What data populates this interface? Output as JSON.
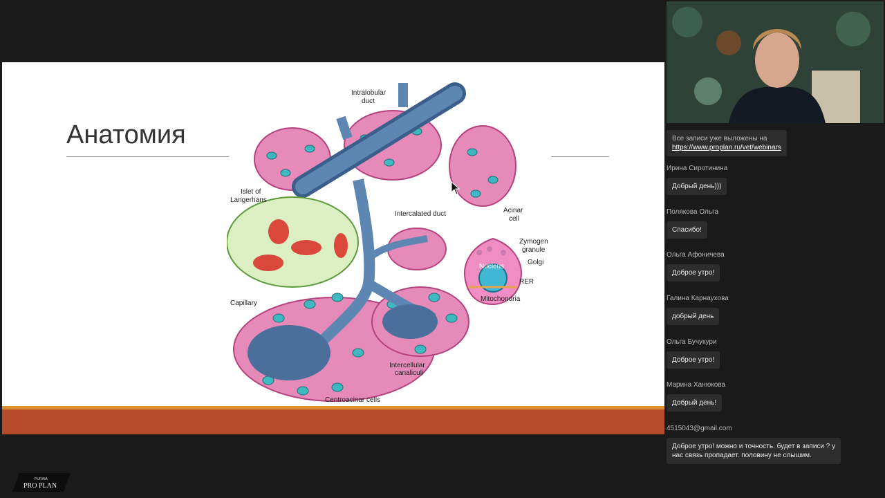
{
  "slide": {
    "title": "Анатомия",
    "labels": {
      "intralobular_duct_1": "Intralobular",
      "intralobular_duct_2": "duct",
      "islet_1": "Islet of",
      "islet_2": "Langerhans",
      "intercalated_duct": "Intercalated duct",
      "acinar_cell_1": "Acinar",
      "acinar_cell_2": "cell",
      "zymogen_1": "Zymogen",
      "zymogen_2": "granule",
      "golgi": "Golgi",
      "nucleus": "Nucleus",
      "rer": "RER",
      "mitochondria": "Mitochondria",
      "capillary": "Capillary",
      "intercellular_1": "Intercellular",
      "intercellular_2": "canaliculi",
      "centroacinar": "Centroacinar cells"
    },
    "colors": {
      "footer_accent": "#e0932d",
      "footer_bar": "#b5492a"
    }
  },
  "chat": {
    "notice": {
      "text": "Все записи уже выложены на",
      "link": "https://www.proplan.ru/vet/webinars"
    },
    "messages": [
      {
        "author": "Ирина Сиротинина",
        "text": "Добрый день)))"
      },
      {
        "author": "Полякова Ольга",
        "text": "Спасибо!"
      },
      {
        "author": "Ольга Афоничева",
        "text": "Доброе утро!"
      },
      {
        "author": "Галина Карнаухова",
        "text": "добрый день"
      },
      {
        "author": "Ольга Бучукури",
        "text": "Доброе утро!"
      },
      {
        "author": "Марина Ханюкова",
        "text": "Добрый день!"
      },
      {
        "author": "4515043@gmail.com",
        "text_line1": "Доброе утро! можно и точность. будет в записи ? у",
        "text_line2": "нас связь пропадает. половину не слышим."
      }
    ]
  },
  "logo": {
    "brand_top": "PURINA",
    "brand": "PRO PLAN"
  }
}
